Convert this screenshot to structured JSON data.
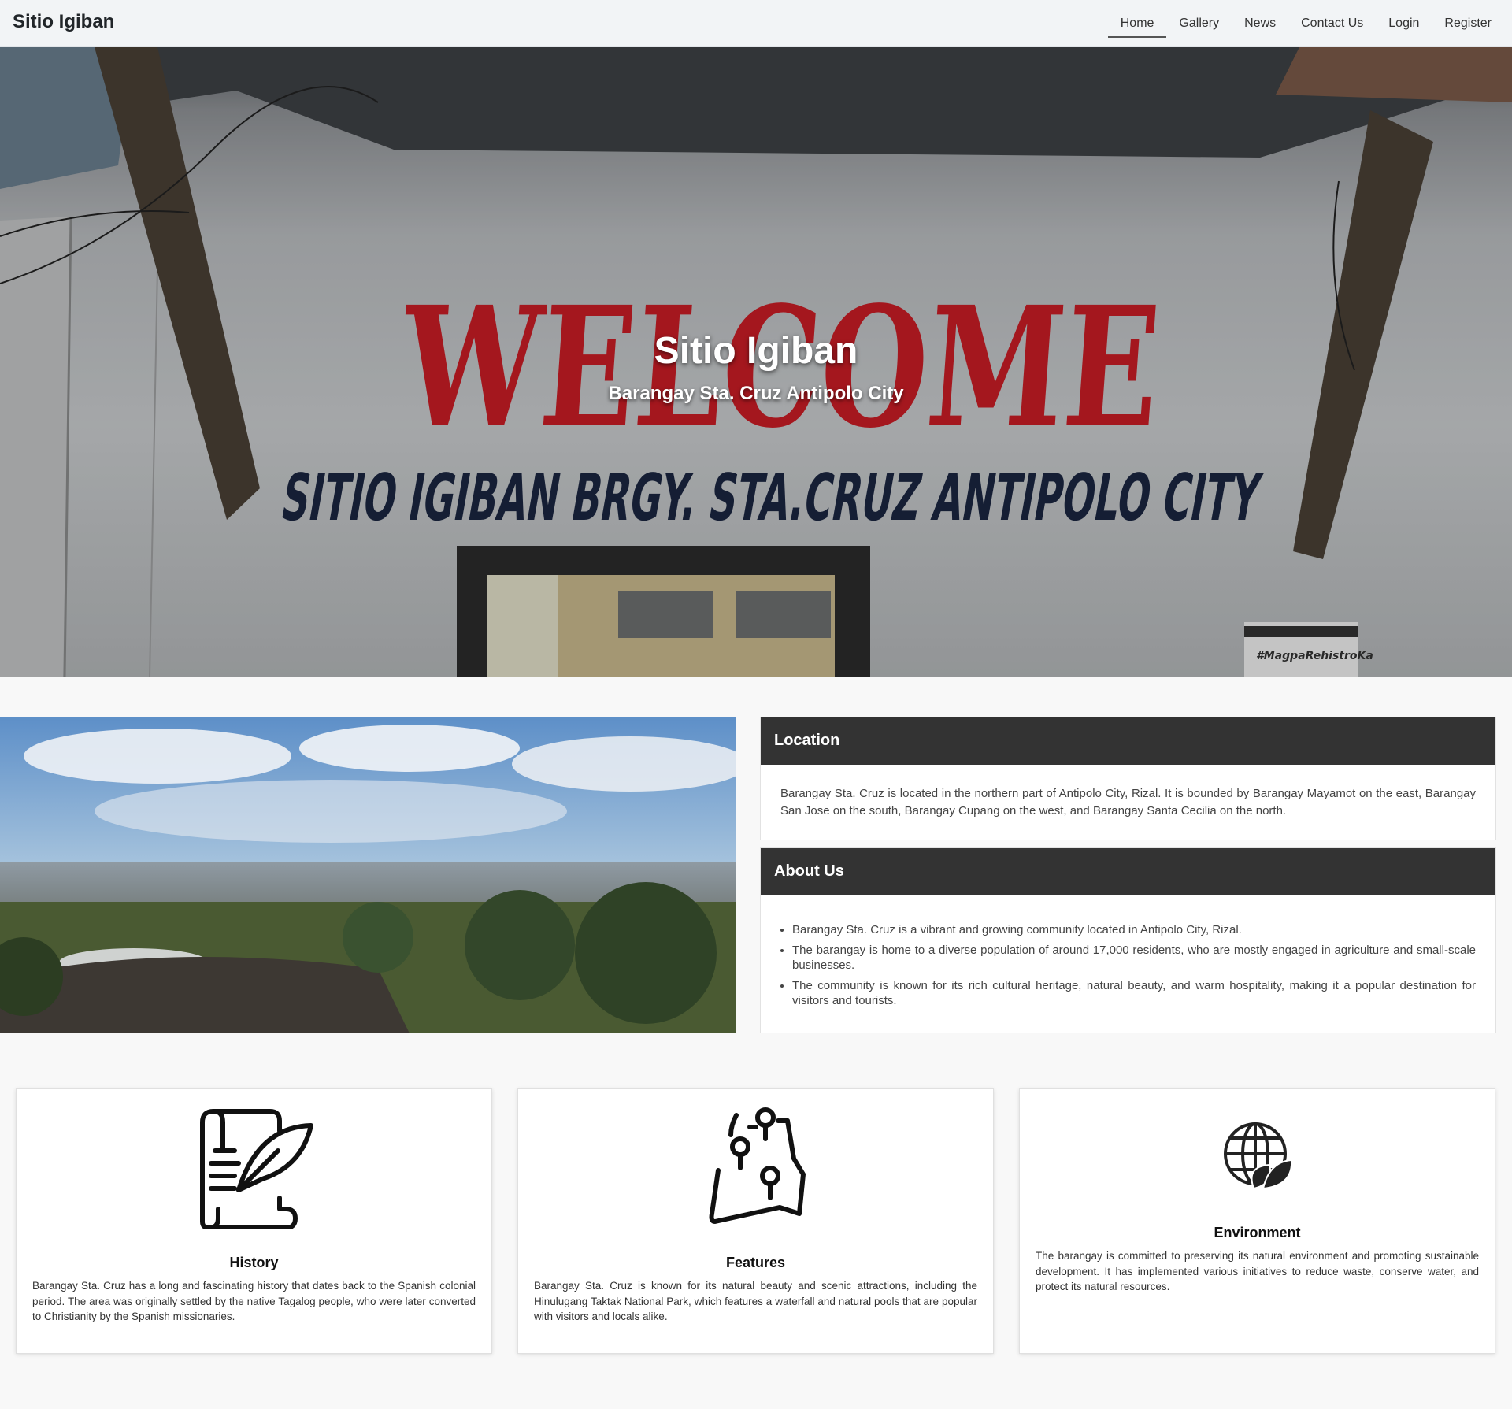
{
  "brand": "Sitio Igiban",
  "nav": {
    "items": [
      {
        "label": "Home",
        "active": true
      },
      {
        "label": "Gallery"
      },
      {
        "label": "News"
      },
      {
        "label": "Contact Us"
      },
      {
        "label": "Login"
      },
      {
        "label": "Register"
      }
    ]
  },
  "hero": {
    "title": "Sitio Igiban",
    "subtitle": "Barangay Sta. Cruz Antipolo City",
    "sign_welcome": "WELCOME",
    "sign_text": "SITIO IGIBAN BRGY. STA.CRUZ ANTIPOLO CITY",
    "sticker_text": "#MagpaRehistroKa"
  },
  "location": {
    "heading": "Location",
    "text": "Barangay Sta. Cruz is located in the northern part of Antipolo City, Rizal. It is bounded by Barangay Mayamot on the east, Barangay San Jose on the south, Barangay Cupang on the west, and Barangay Santa Cecilia on the north."
  },
  "about": {
    "heading": "About Us",
    "items": [
      "Barangay Sta. Cruz is a vibrant and growing community located in Antipolo City, Rizal.",
      "The barangay is home to a diverse population of around 17,000 residents, who are mostly engaged in agriculture and small-scale businesses.",
      "The community is known for its rich cultural heritage, natural beauty, and warm hospitality, making it a popular destination for visitors and tourists."
    ]
  },
  "cards": [
    {
      "title": "History",
      "icon": "scroll-quill-icon",
      "text": "Barangay Sta. Cruz has a long and fascinating history that dates back to the Spanish colonial period. The area was originally settled by the native Tagalog people, who were later converted to Christianity by the Spanish missionaries."
    },
    {
      "title": "Features",
      "icon": "map-pins-icon",
      "text": "Barangay Sta. Cruz is known for its natural beauty and scenic attractions, including the Hinulugang Taktak National Park, which features a waterfall and natural pools that are popular with visitors and locals alike."
    },
    {
      "title": "Environment",
      "icon": "globe-leaf-icon",
      "text": "The barangay is committed to preserving its natural environment and promoting sustainable development. It has implemented various initiatives to reduce waste, conserve water, and protect its natural resources."
    }
  ]
}
